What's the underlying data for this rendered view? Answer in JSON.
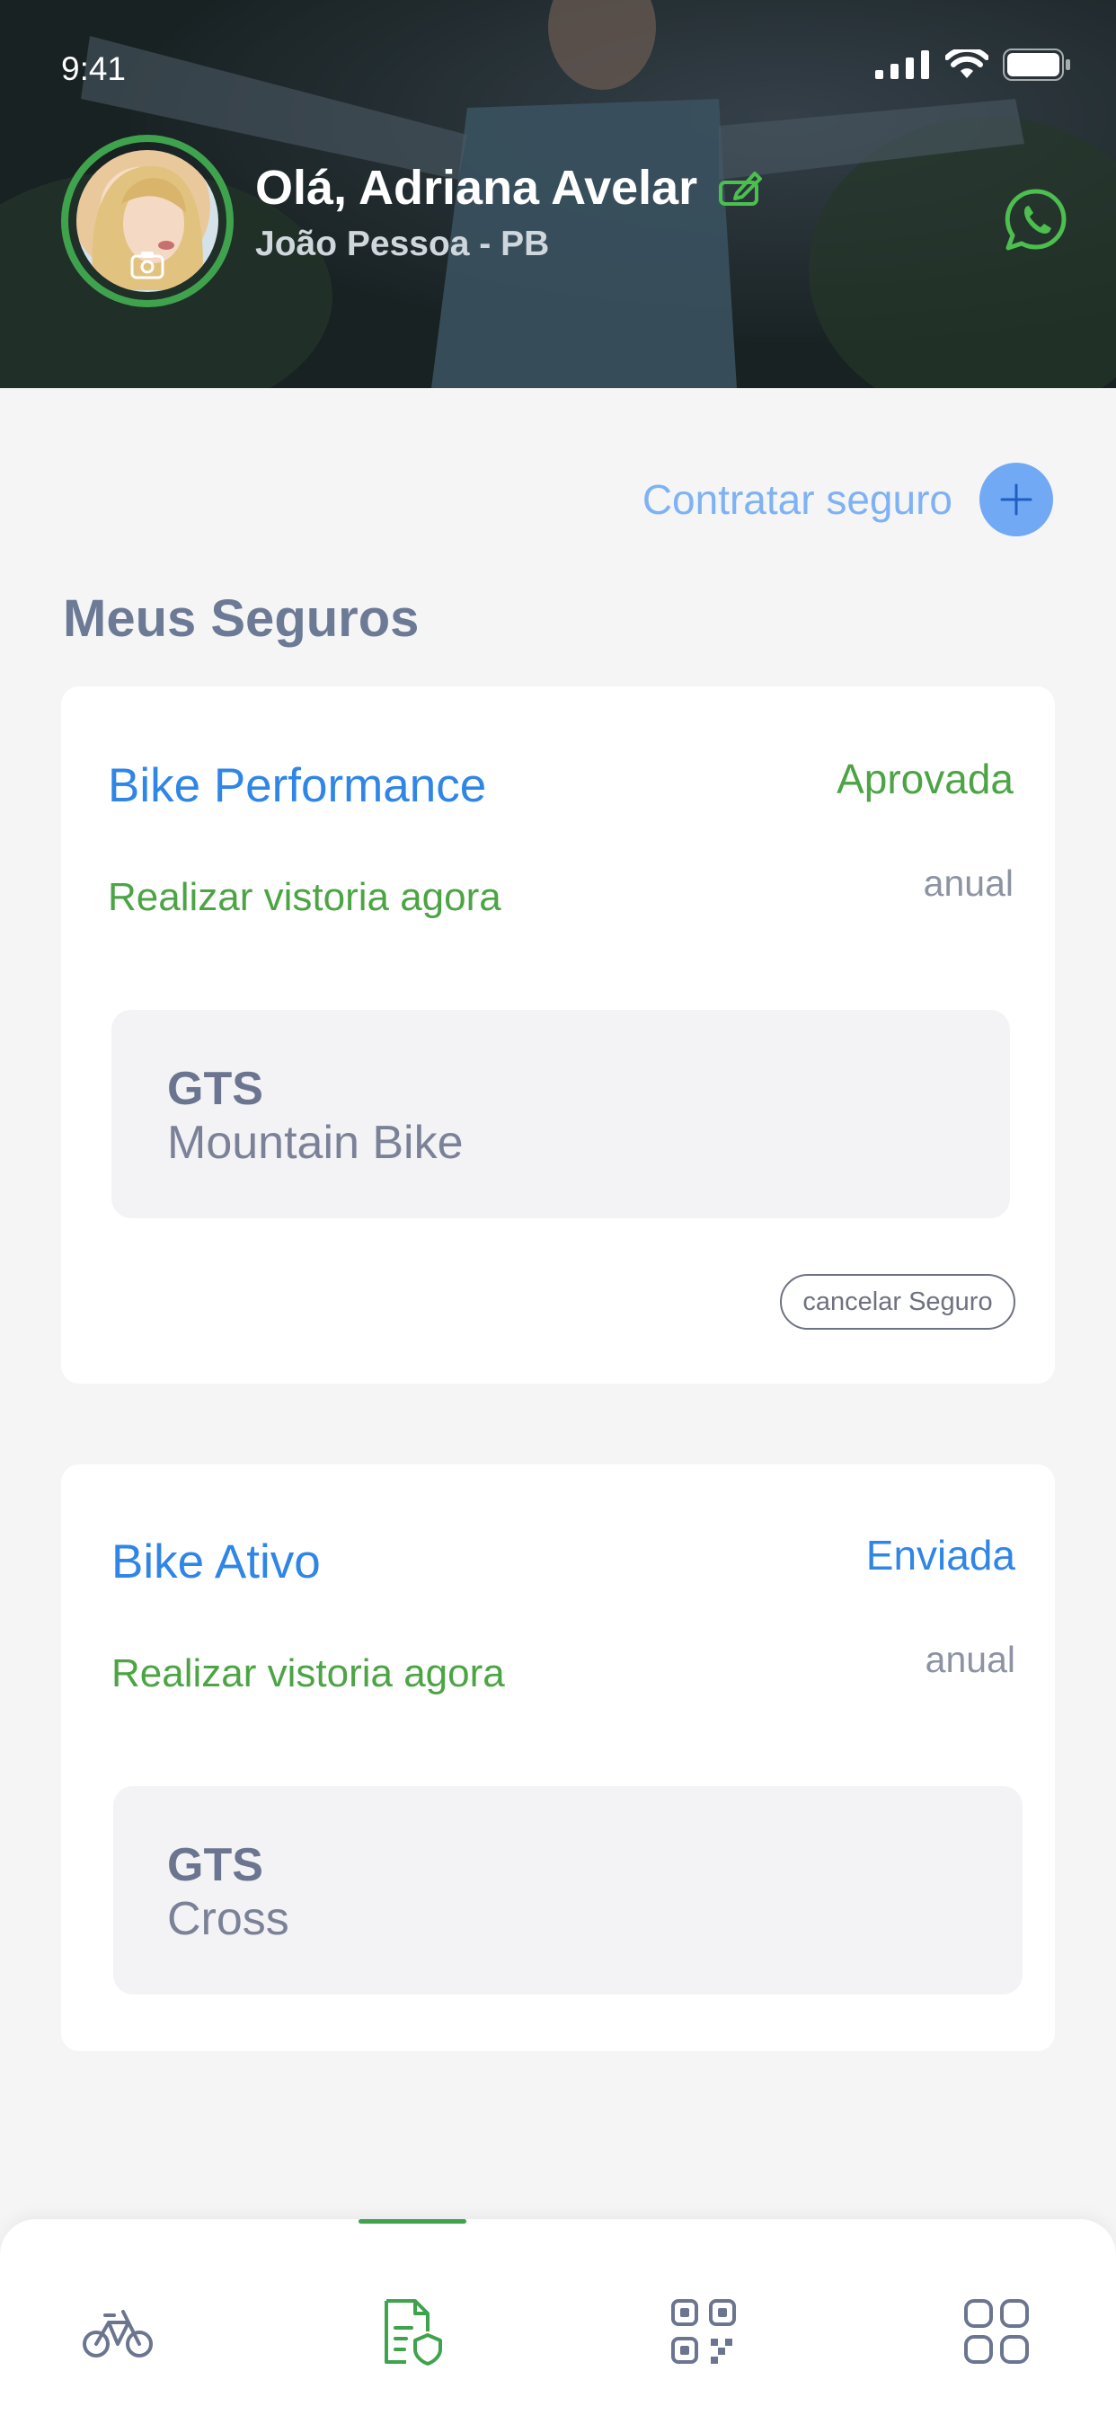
{
  "status_bar": {
    "time": "9:41"
  },
  "header": {
    "greeting": "Olá, Adriana Avelar",
    "location": "João Pessoa - PB"
  },
  "actions": {
    "contract_label": "Contratar seguro"
  },
  "section": {
    "title": "Meus Seguros"
  },
  "insurances": [
    {
      "plan": "Bike Performance",
      "status": "Aprovada",
      "status_color": "#4ca444",
      "inspection_link": "Realizar vistoria agora",
      "period": "anual",
      "bike_brand": "GTS",
      "bike_model": "Mountain Bike",
      "cancel_label": "cancelar Seguro"
    },
    {
      "plan": "Bike Ativo",
      "status": "Enviada",
      "status_color": "#2f86e6",
      "inspection_link": "Realizar vistoria agora",
      "period": "anual",
      "bike_brand": "GTS",
      "bike_model": "Cross"
    }
  ],
  "tabbar": {
    "tabs": [
      {
        "icon": "bike-icon"
      },
      {
        "icon": "insurance-document-icon",
        "active": true
      },
      {
        "icon": "qr-code-icon"
      },
      {
        "icon": "grid-menu-icon"
      }
    ]
  },
  "colors": {
    "accent_green": "#3fa34d",
    "accent_blue": "#2f86e6",
    "cta_blue": "#72a9f5"
  }
}
